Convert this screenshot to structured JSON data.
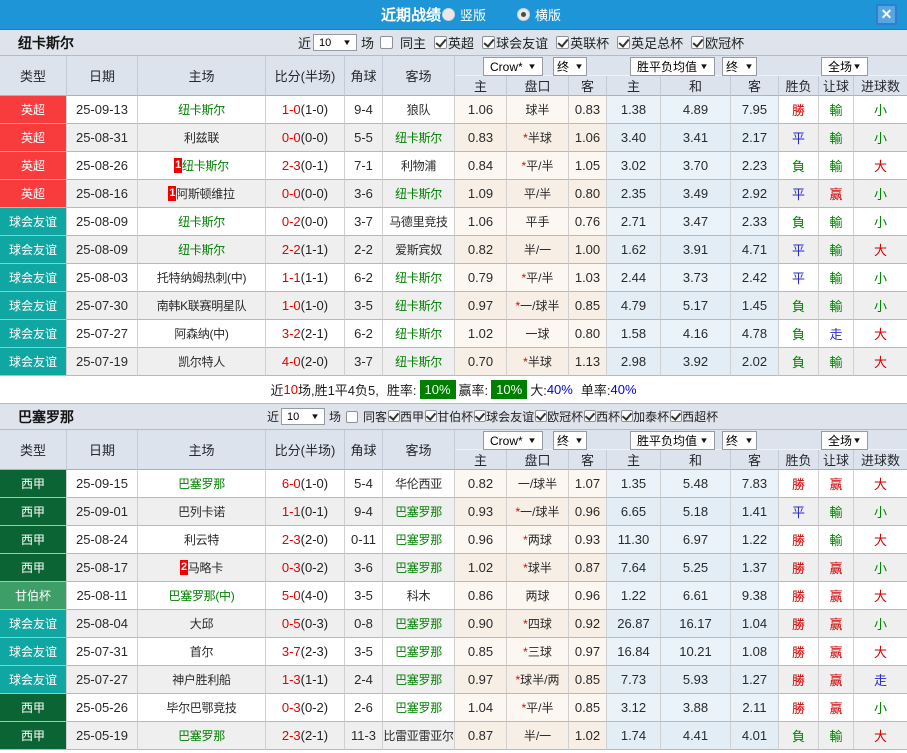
{
  "titlebar": {
    "title": "近期战绩",
    "radios": [
      {
        "label": "竖版",
        "checked": false
      },
      {
        "label": "横版",
        "checked": true
      }
    ],
    "close_label": "×"
  },
  "colors": {
    "titlebar_bg": "#1d95d7",
    "focus_team_green": "#008000",
    "score_red": "#e60000",
    "league_badges": {
      "英超": "#f83b3d",
      "球会友谊": "#10a7a3",
      "西甲": "#0b6433",
      "甘伯杯": "#3e9e68"
    },
    "outcomes": {
      "勝": "#cf0000",
      "赢": "#cf0000",
      "大": "#cf0000",
      "平": "#2a2ad4",
      "走": "#2a2ad4",
      "負": "#008000",
      "輸": "#008000",
      "小": "#008000"
    },
    "summary_badge_bg": "#008000",
    "summary_value_blue": "#0000e0"
  },
  "table_header": {
    "type": "类型",
    "date": "日期",
    "home": "主场",
    "score": "比分(半场)",
    "corner": "角球",
    "away": "客场",
    "odds_select": "Crow*",
    "odds_final_select": "终",
    "sub_home": "主",
    "sub_handicap": "盘口",
    "sub_away": "客",
    "avg_select": "胜平负均值",
    "avg_final_select": "终",
    "avg_home": "主",
    "avg_draw": "和",
    "avg_away": "客",
    "scope_select": "全场",
    "sub_result": "胜负",
    "sub_let": "让球",
    "sub_goals": "进球数"
  },
  "sections": [
    {
      "team": "纽卡斯尔",
      "filter": {
        "near_label": "近",
        "count": "10",
        "games_label": "场",
        "same_side": {
          "label": "同主",
          "checked": false
        },
        "competitions": [
          {
            "label": "英超",
            "checked": true
          },
          {
            "label": "球会友谊",
            "checked": true
          },
          {
            "label": "英联杯",
            "checked": true
          },
          {
            "label": "英足总杯",
            "checked": true
          },
          {
            "label": "欧冠杯",
            "checked": true
          }
        ]
      },
      "rows": [
        {
          "league": "英超",
          "date": "25-09-13",
          "home": "纽卡斯尔",
          "home_focus": true,
          "home_badge": "",
          "score_ft": "1-0",
          "score_ht": "(1-0)",
          "corner": "9-4",
          "away": "狼队",
          "away_focus": false,
          "odds_home": "1.06",
          "handicap_star": false,
          "handicap": "球半",
          "odds_away": "0.83",
          "avg_home": "1.38",
          "avg_draw": "4.89",
          "avg_away": "7.95",
          "result": "勝",
          "let_ball": "輸",
          "goals": "小"
        },
        {
          "league": "英超",
          "date": "25-08-31",
          "home": "利兹联",
          "home_focus": false,
          "home_badge": "",
          "score_ft": "0-0",
          "score_ht": "(0-0)",
          "corner": "5-5",
          "away": "纽卡斯尔",
          "away_focus": true,
          "odds_home": "0.83",
          "handicap_star": true,
          "handicap": "半球",
          "odds_away": "1.06",
          "avg_home": "3.40",
          "avg_draw": "3.41",
          "avg_away": "2.17",
          "result": "平",
          "let_ball": "輸",
          "goals": "小"
        },
        {
          "league": "英超",
          "date": "25-08-26",
          "home": "纽卡斯尔",
          "home_focus": true,
          "home_badge": "1",
          "score_ft": "2-3",
          "score_ht": "(0-1)",
          "corner": "7-1",
          "away": "利物浦",
          "away_focus": false,
          "odds_home": "0.84",
          "handicap_star": true,
          "handicap": "平/半",
          "odds_away": "1.05",
          "avg_home": "3.02",
          "avg_draw": "3.70",
          "avg_away": "2.23",
          "result": "負",
          "let_ball": "輸",
          "goals": "大"
        },
        {
          "league": "英超",
          "date": "25-08-16",
          "home": "阿斯顿维拉",
          "home_focus": false,
          "home_badge": "1",
          "score_ft": "0-0",
          "score_ht": "(0-0)",
          "corner": "3-6",
          "away": "纽卡斯尔",
          "away_focus": true,
          "odds_home": "1.09",
          "handicap_star": false,
          "handicap": "平/半",
          "odds_away": "0.80",
          "avg_home": "2.35",
          "avg_draw": "3.49",
          "avg_away": "2.92",
          "result": "平",
          "let_ball": "赢",
          "goals": "小"
        },
        {
          "league": "球会友谊",
          "date": "25-08-09",
          "home": "纽卡斯尔",
          "home_focus": true,
          "home_badge": "",
          "score_ft": "0-2",
          "score_ht": "(0-0)",
          "corner": "3-7",
          "away": "马德里竞技",
          "away_focus": false,
          "odds_home": "1.06",
          "handicap_star": false,
          "handicap": "平手",
          "odds_away": "0.76",
          "avg_home": "2.71",
          "avg_draw": "3.47",
          "avg_away": "2.33",
          "result": "負",
          "let_ball": "輸",
          "goals": "小"
        },
        {
          "league": "球会友谊",
          "date": "25-08-09",
          "home": "纽卡斯尔",
          "home_focus": true,
          "home_badge": "",
          "score_ft": "2-2",
          "score_ht": "(1-1)",
          "corner": "2-2",
          "away": "爱斯宾奴",
          "away_focus": false,
          "odds_home": "0.82",
          "handicap_star": false,
          "handicap": "半/一",
          "odds_away": "1.00",
          "avg_home": "1.62",
          "avg_draw": "3.91",
          "avg_away": "4.71",
          "result": "平",
          "let_ball": "輸",
          "goals": "大"
        },
        {
          "league": "球会友谊",
          "date": "25-08-03",
          "home": "托特纳姆热刺(中)",
          "home_focus": false,
          "home_badge": "",
          "score_ft": "1-1",
          "score_ht": "(1-1)",
          "corner": "6-2",
          "away": "纽卡斯尔",
          "away_focus": true,
          "odds_home": "0.79",
          "handicap_star": true,
          "handicap": "平/半",
          "odds_away": "1.03",
          "avg_home": "2.44",
          "avg_draw": "3.73",
          "avg_away": "2.42",
          "result": "平",
          "let_ball": "輸",
          "goals": "小"
        },
        {
          "league": "球会友谊",
          "date": "25-07-30",
          "home": "南韩K联赛明星队",
          "home_focus": false,
          "home_badge": "",
          "score_ft": "1-0",
          "score_ht": "(1-0)",
          "corner": "3-5",
          "away": "纽卡斯尔",
          "away_focus": true,
          "odds_home": "0.97",
          "handicap_star": true,
          "handicap": "一/球半",
          "odds_away": "0.85",
          "avg_home": "4.79",
          "avg_draw": "5.17",
          "avg_away": "1.45",
          "result": "負",
          "let_ball": "輸",
          "goals": "小"
        },
        {
          "league": "球会友谊",
          "date": "25-07-27",
          "home": "阿森纳(中)",
          "home_focus": false,
          "home_badge": "",
          "score_ft": "3-2",
          "score_ht": "(2-1)",
          "corner": "6-2",
          "away": "纽卡斯尔",
          "away_focus": true,
          "odds_home": "1.02",
          "handicap_star": false,
          "handicap": "一球",
          "odds_away": "0.80",
          "avg_home": "1.58",
          "avg_draw": "4.16",
          "avg_away": "4.78",
          "result": "負",
          "let_ball": "走",
          "goals": "大"
        },
        {
          "league": "球会友谊",
          "date": "25-07-19",
          "home": "凯尔特人",
          "home_focus": false,
          "home_badge": "",
          "score_ft": "4-0",
          "score_ht": "(2-0)",
          "corner": "3-7",
          "away": "纽卡斯尔",
          "away_focus": true,
          "odds_home": "0.70",
          "handicap_star": true,
          "handicap": "半球",
          "odds_away": "1.13",
          "avg_home": "2.98",
          "avg_draw": "3.92",
          "avg_away": "2.02",
          "result": "負",
          "let_ball": "輸",
          "goals": "大"
        }
      ],
      "summary": {
        "near_label": "近",
        "games": "10",
        "record": "场,胜1平4负5,",
        "win_rate_label": "胜率:",
        "win_rate": "10%",
        "profit_rate_label": "赢率:",
        "profit_rate": "10%",
        "big_label": "大:",
        "big_rate": "40%",
        "single_label": "单率:",
        "single_rate": "40%"
      }
    },
    {
      "team": "巴塞罗那",
      "filter": {
        "near_label": "近",
        "count": "10",
        "games_label": "场",
        "same_side": {
          "label": "同客",
          "checked": false
        },
        "competitions": [
          {
            "label": "西甲",
            "checked": true
          },
          {
            "label": "甘伯杯",
            "checked": true
          },
          {
            "label": "球会友谊",
            "checked": true
          },
          {
            "label": "欧冠杯",
            "checked": true
          },
          {
            "label": "西杯",
            "checked": true
          },
          {
            "label": "加泰杯",
            "checked": true
          },
          {
            "label": "西超杯",
            "checked": true
          }
        ]
      },
      "rows": [
        {
          "league": "西甲",
          "date": "25-09-15",
          "home": "巴塞罗那",
          "home_focus": true,
          "home_badge": "",
          "score_ft": "6-0",
          "score_ht": "(1-0)",
          "corner": "5-4",
          "away": "华伦西亚",
          "away_focus": false,
          "odds_home": "0.82",
          "handicap_star": false,
          "handicap": "一/球半",
          "odds_away": "1.07",
          "avg_home": "1.35",
          "avg_draw": "5.48",
          "avg_away": "7.83",
          "result": "勝",
          "let_ball": "赢",
          "goals": "大"
        },
        {
          "league": "西甲",
          "date": "25-09-01",
          "home": "巴列卡诺",
          "home_focus": false,
          "home_badge": "",
          "score_ft": "1-1",
          "score_ht": "(0-1)",
          "corner": "9-4",
          "away": "巴塞罗那",
          "away_focus": true,
          "odds_home": "0.93",
          "handicap_star": true,
          "handicap": "一/球半",
          "odds_away": "0.96",
          "avg_home": "6.65",
          "avg_draw": "5.18",
          "avg_away": "1.41",
          "result": "平",
          "let_ball": "輸",
          "goals": "小"
        },
        {
          "league": "西甲",
          "date": "25-08-24",
          "home": "利云特",
          "home_focus": false,
          "home_badge": "",
          "score_ft": "2-3",
          "score_ht": "(2-0)",
          "corner": "0-11",
          "away": "巴塞罗那",
          "away_focus": true,
          "odds_home": "0.96",
          "handicap_star": true,
          "handicap": "两球",
          "odds_away": "0.93",
          "avg_home": "11.30",
          "avg_draw": "6.97",
          "avg_away": "1.22",
          "result": "勝",
          "let_ball": "輸",
          "goals": "大"
        },
        {
          "league": "西甲",
          "date": "25-08-17",
          "home": "马略卡",
          "home_focus": false,
          "home_badge": "2",
          "score_ft": "0-3",
          "score_ht": "(0-2)",
          "corner": "3-6",
          "away": "巴塞罗那",
          "away_focus": true,
          "odds_home": "1.02",
          "handicap_star": true,
          "handicap": "球半",
          "odds_away": "0.87",
          "avg_home": "7.64",
          "avg_draw": "5.25",
          "avg_away": "1.37",
          "result": "勝",
          "let_ball": "赢",
          "goals": "小"
        },
        {
          "league": "甘伯杯",
          "date": "25-08-11",
          "home": "巴塞罗那(中)",
          "home_focus": true,
          "home_badge": "",
          "score_ft": "5-0",
          "score_ht": "(4-0)",
          "corner": "3-5",
          "away": "科木",
          "away_focus": false,
          "odds_home": "0.86",
          "handicap_star": false,
          "handicap": "两球",
          "odds_away": "0.96",
          "avg_home": "1.22",
          "avg_draw": "6.61",
          "avg_away": "9.38",
          "result": "勝",
          "let_ball": "赢",
          "goals": "大"
        },
        {
          "league": "球会友谊",
          "date": "25-08-04",
          "home": "大邱",
          "home_focus": false,
          "home_badge": "",
          "score_ft": "0-5",
          "score_ht": "(0-3)",
          "corner": "0-8",
          "away": "巴塞罗那",
          "away_focus": true,
          "odds_home": "0.90",
          "handicap_star": true,
          "handicap": "四球",
          "odds_away": "0.92",
          "avg_home": "26.87",
          "avg_draw": "16.17",
          "avg_away": "1.04",
          "result": "勝",
          "let_ball": "赢",
          "goals": "小"
        },
        {
          "league": "球会友谊",
          "date": "25-07-31",
          "home": "首尔",
          "home_focus": false,
          "home_badge": "",
          "score_ft": "3-7",
          "score_ht": "(2-3)",
          "corner": "3-5",
          "away": "巴塞罗那",
          "away_focus": true,
          "odds_home": "0.85",
          "handicap_star": true,
          "handicap": "三球",
          "odds_away": "0.97",
          "avg_home": "16.84",
          "avg_draw": "10.21",
          "avg_away": "1.08",
          "result": "勝",
          "let_ball": "赢",
          "goals": "大"
        },
        {
          "league": "球会友谊",
          "date": "25-07-27",
          "home": "神户胜利船",
          "home_focus": false,
          "home_badge": "",
          "score_ft": "1-3",
          "score_ht": "(1-1)",
          "corner": "2-4",
          "away": "巴塞罗那",
          "away_focus": true,
          "odds_home": "0.97",
          "handicap_star": true,
          "handicap": "球半/两",
          "odds_away": "0.85",
          "avg_home": "7.73",
          "avg_draw": "5.93",
          "avg_away": "1.27",
          "result": "勝",
          "let_ball": "赢",
          "goals": "走"
        },
        {
          "league": "西甲",
          "date": "25-05-26",
          "home": "毕尔巴鄂竞技",
          "home_focus": false,
          "home_badge": "",
          "score_ft": "0-3",
          "score_ht": "(0-2)",
          "corner": "2-6",
          "away": "巴塞罗那",
          "away_focus": true,
          "odds_home": "1.04",
          "handicap_star": true,
          "handicap": "平/半",
          "odds_away": "0.85",
          "avg_home": "3.12",
          "avg_draw": "3.88",
          "avg_away": "2.11",
          "result": "勝",
          "let_ball": "赢",
          "goals": "小"
        },
        {
          "league": "西甲",
          "date": "25-05-19",
          "home": "巴塞罗那",
          "home_focus": true,
          "home_badge": "",
          "score_ft": "2-3",
          "score_ht": "(2-1)",
          "corner": "11-3",
          "away": "比雷亚雷亚尔",
          "away_focus": false,
          "odds_home": "0.87",
          "handicap_star": false,
          "handicap": "半/一",
          "odds_away": "1.02",
          "avg_home": "1.74",
          "avg_draw": "4.41",
          "avg_away": "4.01",
          "result": "負",
          "let_ball": "輸",
          "goals": "大"
        }
      ],
      "summary": null
    }
  ]
}
